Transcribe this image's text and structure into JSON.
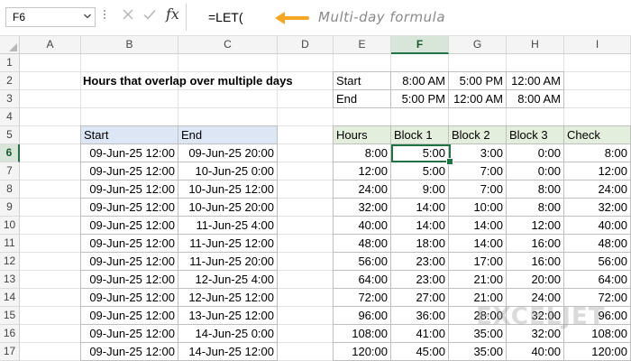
{
  "formula_bar": {
    "name_box": "F6",
    "formula": "=LET(",
    "annotation": "Multi-day formula",
    "accent": "#f5a623"
  },
  "columns": [
    "A",
    "B",
    "C",
    "D",
    "E",
    "F",
    "G",
    "H",
    "I"
  ],
  "active_column": "F",
  "rows": [
    "1",
    "2",
    "3",
    "4",
    "5",
    "6",
    "7",
    "8",
    "9",
    "10",
    "11",
    "12",
    "13",
    "14",
    "15",
    "16",
    "17"
  ],
  "active_row": "6",
  "title": "Hours that overlap over multiple days",
  "blocks_table": {
    "rows": [
      {
        "label": "Start",
        "values": [
          "8:00 AM",
          "5:00 PM",
          "12:00 AM"
        ]
      },
      {
        "label": "End",
        "values": [
          "5:00 PM",
          "12:00 AM",
          "8:00 AM"
        ]
      }
    ]
  },
  "dates_table": {
    "headers": [
      "Start",
      "End"
    ],
    "rows": [
      [
        "09-Jun-25 12:00",
        "09-Jun-25 20:00"
      ],
      [
        "09-Jun-25 12:00",
        "10-Jun-25 0:00"
      ],
      [
        "09-Jun-25 12:00",
        "10-Jun-25 12:00"
      ],
      [
        "09-Jun-25 12:00",
        "10-Jun-25 20:00"
      ],
      [
        "09-Jun-25 12:00",
        "11-Jun-25 4:00"
      ],
      [
        "09-Jun-25 12:00",
        "11-Jun-25 12:00"
      ],
      [
        "09-Jun-25 12:00",
        "11-Jun-25 20:00"
      ],
      [
        "09-Jun-25 12:00",
        "12-Jun-25 4:00"
      ],
      [
        "09-Jun-25 12:00",
        "12-Jun-25 12:00"
      ],
      [
        "09-Jun-25 12:00",
        "13-Jun-25 12:00"
      ],
      [
        "09-Jun-25 12:00",
        "14-Jun-25 0:00"
      ],
      [
        "09-Jun-25 12:00",
        "14-Jun-25 12:00"
      ]
    ]
  },
  "hours_table": {
    "headers": [
      "Hours",
      "Block 1",
      "Block 2",
      "Block 3",
      "Check"
    ],
    "rows": [
      [
        "8:00",
        "5:00",
        "3:00",
        "0:00",
        "8:00"
      ],
      [
        "12:00",
        "5:00",
        "7:00",
        "0:00",
        "12:00"
      ],
      [
        "24:00",
        "9:00",
        "7:00",
        "8:00",
        "24:00"
      ],
      [
        "32:00",
        "14:00",
        "10:00",
        "8:00",
        "32:00"
      ],
      [
        "40:00",
        "14:00",
        "14:00",
        "12:00",
        "40:00"
      ],
      [
        "48:00",
        "18:00",
        "14:00",
        "16:00",
        "48:00"
      ],
      [
        "56:00",
        "23:00",
        "17:00",
        "16:00",
        "56:00"
      ],
      [
        "64:00",
        "23:00",
        "21:00",
        "20:00",
        "64:00"
      ],
      [
        "72:00",
        "27:00",
        "21:00",
        "24:00",
        "72:00"
      ],
      [
        "96:00",
        "36:00",
        "28:00",
        "32:00",
        "96:00"
      ],
      [
        "108:00",
        "41:00",
        "35:00",
        "32:00",
        "108:00"
      ],
      [
        "120:00",
        "45:00",
        "35:00",
        "40:00",
        "120:00"
      ]
    ]
  },
  "watermark": "EXCELJET"
}
